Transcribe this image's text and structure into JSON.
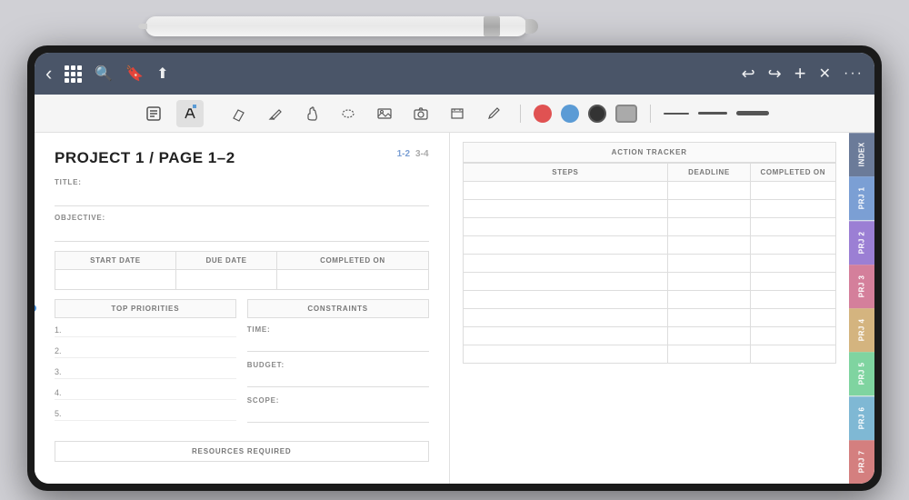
{
  "pencil": {
    "alt": "Apple Pencil"
  },
  "nav": {
    "back_icon": "‹",
    "grid_icon": "grid",
    "search_icon": "🔍",
    "bookmark_icon": "🔖",
    "share_icon": "⬆",
    "undo_icon": "↩",
    "redo_icon": "↪",
    "add_icon": "+",
    "close_icon": "✕",
    "more_icon": "···"
  },
  "toolbar": {
    "tools": [
      {
        "name": "annotate",
        "icon": "⊞"
      },
      {
        "name": "pen",
        "icon": "✒",
        "active": true
      },
      {
        "name": "eraser",
        "icon": "◻"
      },
      {
        "name": "pencil-tool",
        "icon": "✏"
      },
      {
        "name": "hand",
        "icon": "✋"
      },
      {
        "name": "lasso",
        "icon": "◯"
      },
      {
        "name": "image",
        "icon": "⊡"
      },
      {
        "name": "camera",
        "icon": "⊙"
      },
      {
        "name": "text",
        "icon": "⊤"
      },
      {
        "name": "marker",
        "icon": "✐"
      }
    ],
    "colors": [
      {
        "name": "red",
        "hex": "#e05252"
      },
      {
        "name": "blue",
        "hex": "#5b9bd5"
      },
      {
        "name": "black",
        "hex": "#333333"
      }
    ],
    "strokes": [
      {
        "width": 2
      },
      {
        "width": 3
      },
      {
        "width": 5
      }
    ]
  },
  "left_page": {
    "title": "PROJECT 1 / PAGE 1–2",
    "page_num_active": "1-2",
    "page_num_inactive": "3-4",
    "fields": {
      "title_label": "TITLE:",
      "objective_label": "OBJECTIVE:"
    },
    "dates_table": {
      "headers": [
        "START DATE",
        "DUE DATE",
        "COMPLETED ON"
      ]
    },
    "priorities": {
      "header": "TOP PRIORITIES",
      "items": [
        "1.",
        "2.",
        "3.",
        "4.",
        "5."
      ]
    },
    "constraints": {
      "header": "CONSTRAINTS",
      "fields": [
        {
          "label": "TIME:"
        },
        {
          "label": "BUDGET:"
        },
        {
          "label": "SCOPE:"
        }
      ]
    },
    "resources": {
      "label": "RESOURCES REQUIRED"
    }
  },
  "right_page": {
    "tracker": {
      "title": "ACTION TRACKER",
      "headers": [
        "STEPS",
        "DEADLINE",
        "COMPLETED ON"
      ],
      "rows": 10
    }
  },
  "side_tabs": {
    "tabs": [
      {
        "label": "INDEX",
        "color": "#6b7b99"
      },
      {
        "label": "PRJ 1",
        "color": "#7b9fd4"
      },
      {
        "label": "PRJ 2",
        "color": "#9b7fd4"
      },
      {
        "label": "PRJ 3",
        "color": "#d47f9b"
      },
      {
        "label": "PRJ 4",
        "color": "#d4b47f"
      },
      {
        "label": "PRJ 5",
        "color": "#7fd4a0"
      },
      {
        "label": "PRJ 6",
        "color": "#7fb8d4"
      },
      {
        "label": "PRJ 7",
        "color": "#d47f7f"
      }
    ]
  }
}
